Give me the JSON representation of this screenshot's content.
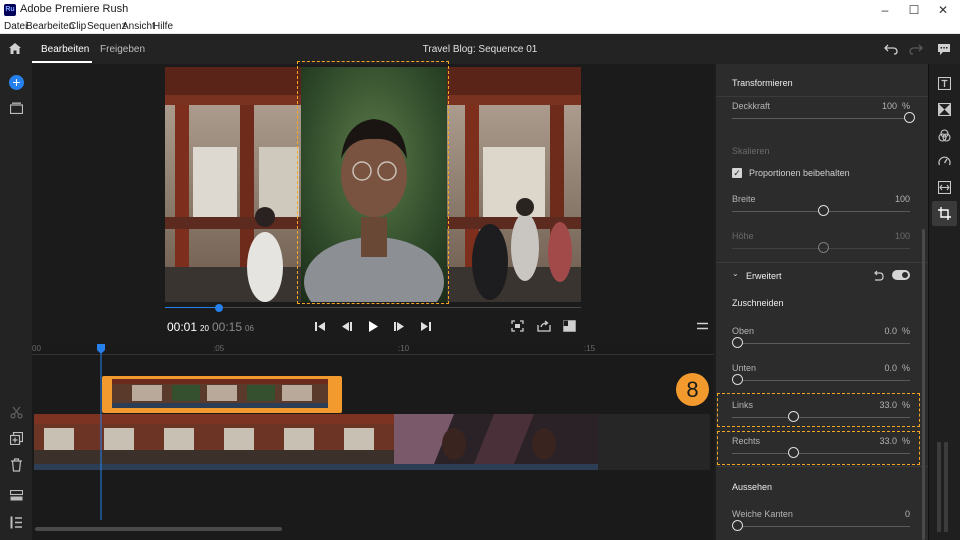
{
  "app": {
    "title": "Adobe Premiere Rush",
    "logo_text": "Ru"
  },
  "menu": [
    "Datei",
    "Bearbeiten",
    "Clip",
    "Sequenz",
    "Ansicht",
    "Hilfe"
  ],
  "header": {
    "tabs": [
      "Bearbeiten",
      "Freigeben"
    ],
    "active_tab": "Bearbeiten",
    "sequence_title": "Travel Blog: Sequence 01"
  },
  "player": {
    "current_time": "00:01",
    "current_frames": "20",
    "total_time": "00:15",
    "total_frames": "06",
    "scrub_progress": 0.13
  },
  "timeline": {
    "ruler_labels": [
      "00",
      ":05",
      ":10",
      ":15"
    ]
  },
  "panel": {
    "transform": {
      "title": "Transformieren",
      "opacity_label": "Deckkraft",
      "opacity_value": "100",
      "opacity_unit": "%",
      "opacity_level": 1.0,
      "scale_title": "Skalieren",
      "keep_proportions_label": "Proportionen beibehalten",
      "keep_proportions_checked": true,
      "width_label": "Breite",
      "width_value": "100",
      "height_label": "Höhe",
      "height_value": "100"
    },
    "advanced": {
      "title": "Erweitert",
      "enabled": true,
      "crop_title": "Zuschneiden",
      "top_label": "Oben",
      "top_value": "0.0",
      "bottom_label": "Unten",
      "bottom_value": "0.0",
      "left_label": "Links",
      "left_value": "33.0",
      "right_label": "Rechts",
      "right_value": "33.0",
      "unit": "%",
      "appearance_title": "Aussehen",
      "soft_edges_label": "Weiche Kanten",
      "soft_edges_value": "0"
    }
  },
  "callout": {
    "step_number": "8"
  },
  "colors": {
    "accent_blue": "#2680eb",
    "highlight_orange": "#f5a623",
    "panel_bg": "#2c2c2c",
    "app_bg": "#1d1d1d"
  }
}
